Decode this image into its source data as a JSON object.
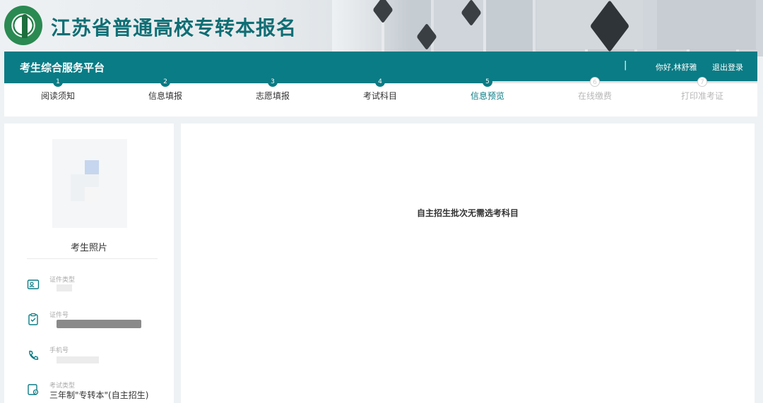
{
  "header": {
    "site_title": "江苏省普通高校专转本报名"
  },
  "navbar": {
    "title": "考生综合服务平台",
    "separator": "|",
    "greeting": "你好,林舒雅",
    "logout": "退出登录",
    "accent": "#0a7c85"
  },
  "steps": [
    {
      "num": "1",
      "label": "阅读须知",
      "state": "done"
    },
    {
      "num": "2",
      "label": "信息填报",
      "state": "done"
    },
    {
      "num": "3",
      "label": "志愿填报",
      "state": "done"
    },
    {
      "num": "4",
      "label": "考试科目",
      "state": "done"
    },
    {
      "num": "5",
      "label": "信息预览",
      "state": "active"
    },
    {
      "num": "6",
      "label": "在线缴费",
      "state": "pending"
    },
    {
      "num": "7",
      "label": "打印准考证",
      "state": "pending"
    }
  ],
  "profile": {
    "photo_label": "考生照片",
    "items": [
      {
        "icon": "id-card-icon",
        "label": "证件类型",
        "value": ""
      },
      {
        "icon": "clipboard-check-icon",
        "label": "证件号",
        "value": ""
      },
      {
        "icon": "phone-icon",
        "label": "手机号",
        "value": ""
      },
      {
        "icon": "exam-type-icon",
        "label": "考试类型",
        "value": "三年制\"专转本\"(自主招生)"
      }
    ]
  },
  "main": {
    "message": "自主招生批次无需选考科目"
  }
}
